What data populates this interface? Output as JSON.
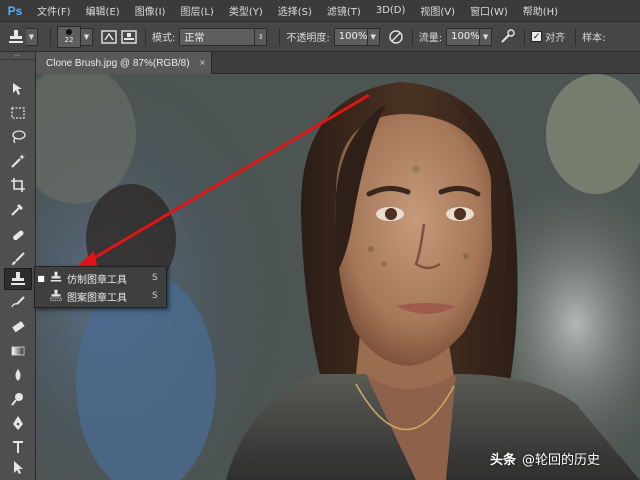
{
  "app": {
    "logo": "Ps"
  },
  "menu": [
    "文件(F)",
    "编辑(E)",
    "图像(I)",
    "图层(L)",
    "类型(Y)",
    "选择(S)",
    "滤镜(T)",
    "3D(D)",
    "视图(V)",
    "窗口(W)",
    "帮助(H)"
  ],
  "options": {
    "brush_size": "22",
    "mode_label": "模式:",
    "mode_value": "正常",
    "opacity_label": "不透明度:",
    "opacity_value": "100%",
    "flow_label": "流量:",
    "flow_value": "100%",
    "aligned_label": "对齐",
    "aligned_checked": true,
    "sample_label": "样本:"
  },
  "document": {
    "tab_title": "Clone Brush.jpg @ 87%(RGB/8)",
    "close_glyph": "×"
  },
  "toolbar": {
    "icons": [
      "move-icon",
      "marquee-icon",
      "lasso-icon",
      "magic-wand-icon",
      "crop-icon",
      "eyedropper-icon",
      "healing-brush-icon",
      "brush-icon",
      "clone-stamp-icon",
      "history-brush-icon",
      "eraser-icon",
      "gradient-icon",
      "blur-icon",
      "dodge-icon",
      "pen-icon",
      "type-icon",
      "path-selection-icon"
    ],
    "active_tool": "clone-stamp-icon"
  },
  "flyout": {
    "items": [
      {
        "label": "仿制图章工具",
        "shortcut": "S",
        "selected": true
      },
      {
        "label": "图案图章工具",
        "shortcut": "S",
        "selected": false
      }
    ]
  },
  "annotation": {
    "arrow_color": "#e01414"
  },
  "watermark": {
    "brand": "头条",
    "handle": "@轮回的历史"
  }
}
